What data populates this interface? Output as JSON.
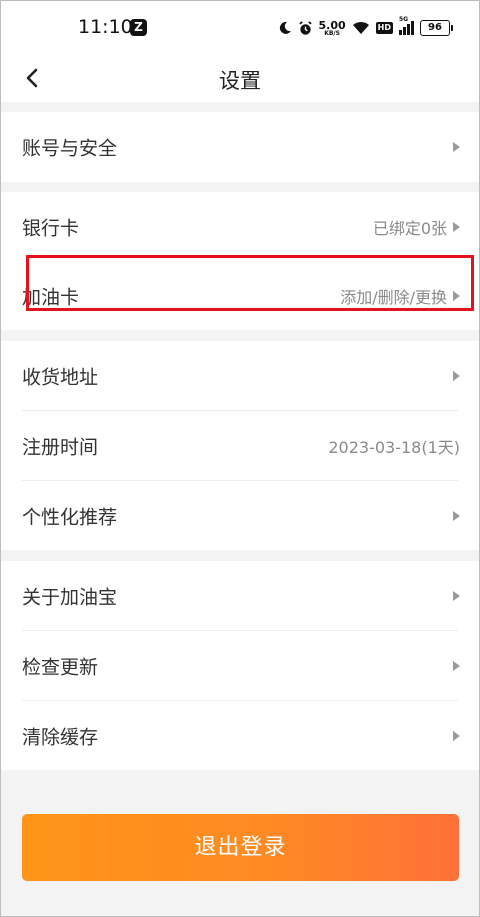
{
  "status_bar": {
    "time": "11:10",
    "app_badge": "Z",
    "net_speed_value": "5.00",
    "net_speed_unit": "KB/S",
    "hd_label": "HD",
    "signal_label": "5G",
    "battery": "96"
  },
  "header": {
    "title": "设置"
  },
  "groups": {
    "g1": [
      {
        "label": "账号与安全",
        "value": ""
      }
    ],
    "g2": [
      {
        "label": "银行卡",
        "value": "已绑定0张"
      },
      {
        "label": "加油卡",
        "value": "添加/删除/更换"
      }
    ],
    "g3": [
      {
        "label": "收货地址",
        "value": ""
      },
      {
        "label": "注册时间",
        "value": "2023-03-18(1天)"
      },
      {
        "label": "个性化推荐",
        "value": ""
      }
    ],
    "g4": [
      {
        "label": "关于加油宝",
        "value": ""
      },
      {
        "label": "检查更新",
        "value": ""
      },
      {
        "label": "清除缓存",
        "value": ""
      }
    ]
  },
  "logout_label": "退出登录",
  "colors": {
    "accent_start": "#ff9418",
    "accent_end": "#ff7138",
    "highlight": "#e5121b"
  }
}
